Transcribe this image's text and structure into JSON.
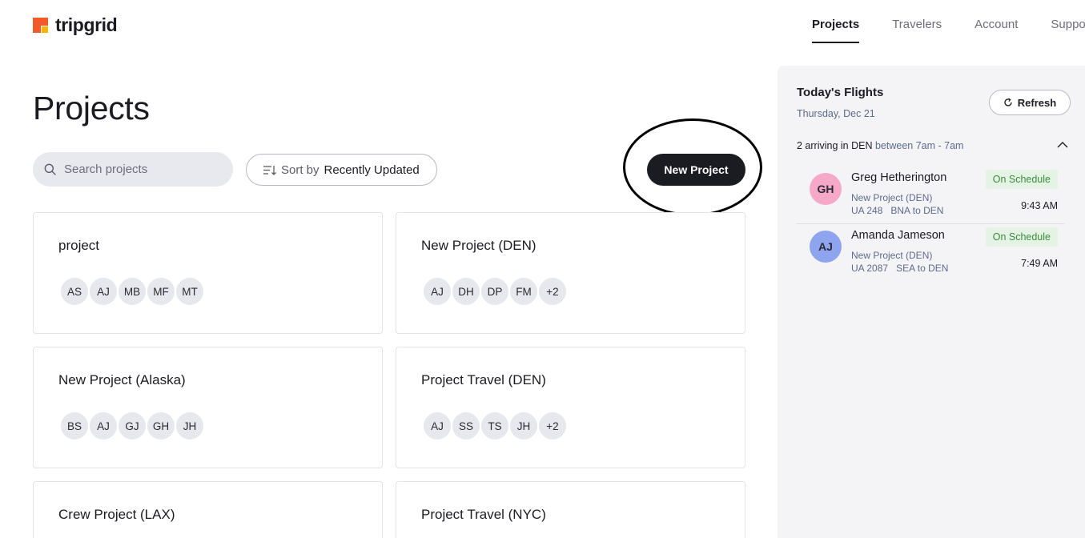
{
  "brand": {
    "name": "tripgrid"
  },
  "nav": [
    {
      "label": "Projects",
      "active": true
    },
    {
      "label": "Travelers",
      "active": false
    },
    {
      "label": "Account",
      "active": false
    },
    {
      "label": "Suppor",
      "active": false
    }
  ],
  "page_title": "Projects",
  "search": {
    "placeholder": "Search projects",
    "icon": "search-icon"
  },
  "sort": {
    "prefix": "Sort by",
    "value": "Recently Updated",
    "icon": "sort-icon"
  },
  "new_project_label": "New Project",
  "projects": [
    {
      "title": "project",
      "avatars": [
        "AS",
        "AJ",
        "MB",
        "MF",
        "MT"
      ]
    },
    {
      "title": "New Project (DEN)",
      "avatars": [
        "AJ",
        "DH",
        "DP",
        "FM",
        "+2"
      ]
    },
    {
      "title": "New Project (Alaska)",
      "avatars": [
        "BS",
        "AJ",
        "GJ",
        "GH",
        "JH"
      ]
    },
    {
      "title": "Project Travel (DEN)",
      "avatars": [
        "AJ",
        "SS",
        "TS",
        "JH",
        "+2"
      ]
    },
    {
      "title": "Crew Project (LAX)",
      "avatars": []
    },
    {
      "title": "Project Travel (NYC)",
      "avatars": []
    }
  ],
  "flights_panel": {
    "title": "Today's Flights",
    "date": "Thursday, Dec 21",
    "refresh_label": "Refresh",
    "arrivals_prefix": "2 arriving in DEN",
    "arrivals_window": "between 7am - 7am",
    "flights": [
      {
        "initials": "GH",
        "avatar_color": "#f6a8c8",
        "name": "Greg Hetherington",
        "project": "New Project (DEN)",
        "flight": "UA 248",
        "route": "BNA to DEN",
        "status": "On Schedule",
        "time": "9:43 AM"
      },
      {
        "initials": "AJ",
        "avatar_color": "#8fa4ee",
        "name": "Amanda Jameson",
        "project": "New Project (DEN)",
        "flight": "UA 2087",
        "route": "SEA to DEN",
        "status": "On Schedule",
        "time": "7:49 AM"
      }
    ]
  },
  "colors": {
    "primary": "#1b1b22",
    "logo_orange": "#f15a2b",
    "logo_yellow": "#f7b500",
    "status_green": "#3b8b3e"
  }
}
